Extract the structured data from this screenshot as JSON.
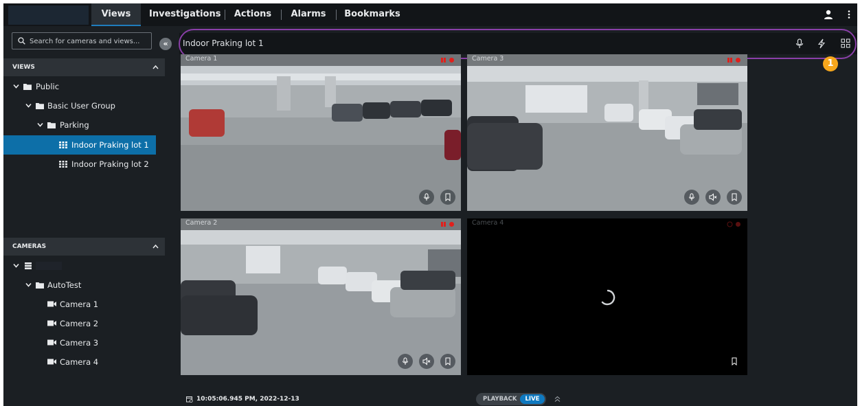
{
  "nav": {
    "tabs": [
      {
        "label": "Views"
      },
      {
        "label": "Investigations"
      },
      {
        "label": "Actions"
      },
      {
        "label": "Alarms"
      },
      {
        "label": "Bookmarks"
      }
    ],
    "active_tab": "Views",
    "icons": [
      "user-icon",
      "kebab-menu-icon"
    ]
  },
  "sidebar": {
    "search_placeholder": "Search for cameras and views...",
    "views_header": "VIEWS",
    "views_tree": [
      {
        "label": "Public"
      },
      {
        "label": "Basic User Group"
      },
      {
        "label": "Parking"
      },
      {
        "label": "Indoor Praking lot 1"
      },
      {
        "label": "Indoor Praking lot 2"
      }
    ],
    "selected_view": "Indoor Praking lot 1",
    "cameras_header": "CAMERAS",
    "cameras_tree": [
      {
        "label": "AutoTest"
      },
      {
        "label": "Camera 1"
      },
      {
        "label": "Camera 2"
      },
      {
        "label": "Camera 3"
      },
      {
        "label": "Camera 4"
      }
    ]
  },
  "viewbar": {
    "title": "Indoor Praking lot 1",
    "icons": [
      "microphone-icon",
      "lightning-icon",
      "grid-layout-icon"
    ],
    "callout_number": "1"
  },
  "tiles": [
    {
      "title": "Camera 1"
    },
    {
      "title": "Camera 3"
    },
    {
      "title": "Camera 2"
    },
    {
      "title": "Camera 4"
    }
  ],
  "footer": {
    "timestamp": "10:05:06.945 PM, 2022-12-13",
    "playback_label": "PLAYBACK",
    "live_label": "LIVE"
  },
  "colors": {
    "accent": "#0f79c0",
    "selected_row": "#0d6fa8",
    "highlight_oval": "#8a3fa8",
    "callout_badge": "#f7a71c",
    "recording": "#e0201c"
  }
}
